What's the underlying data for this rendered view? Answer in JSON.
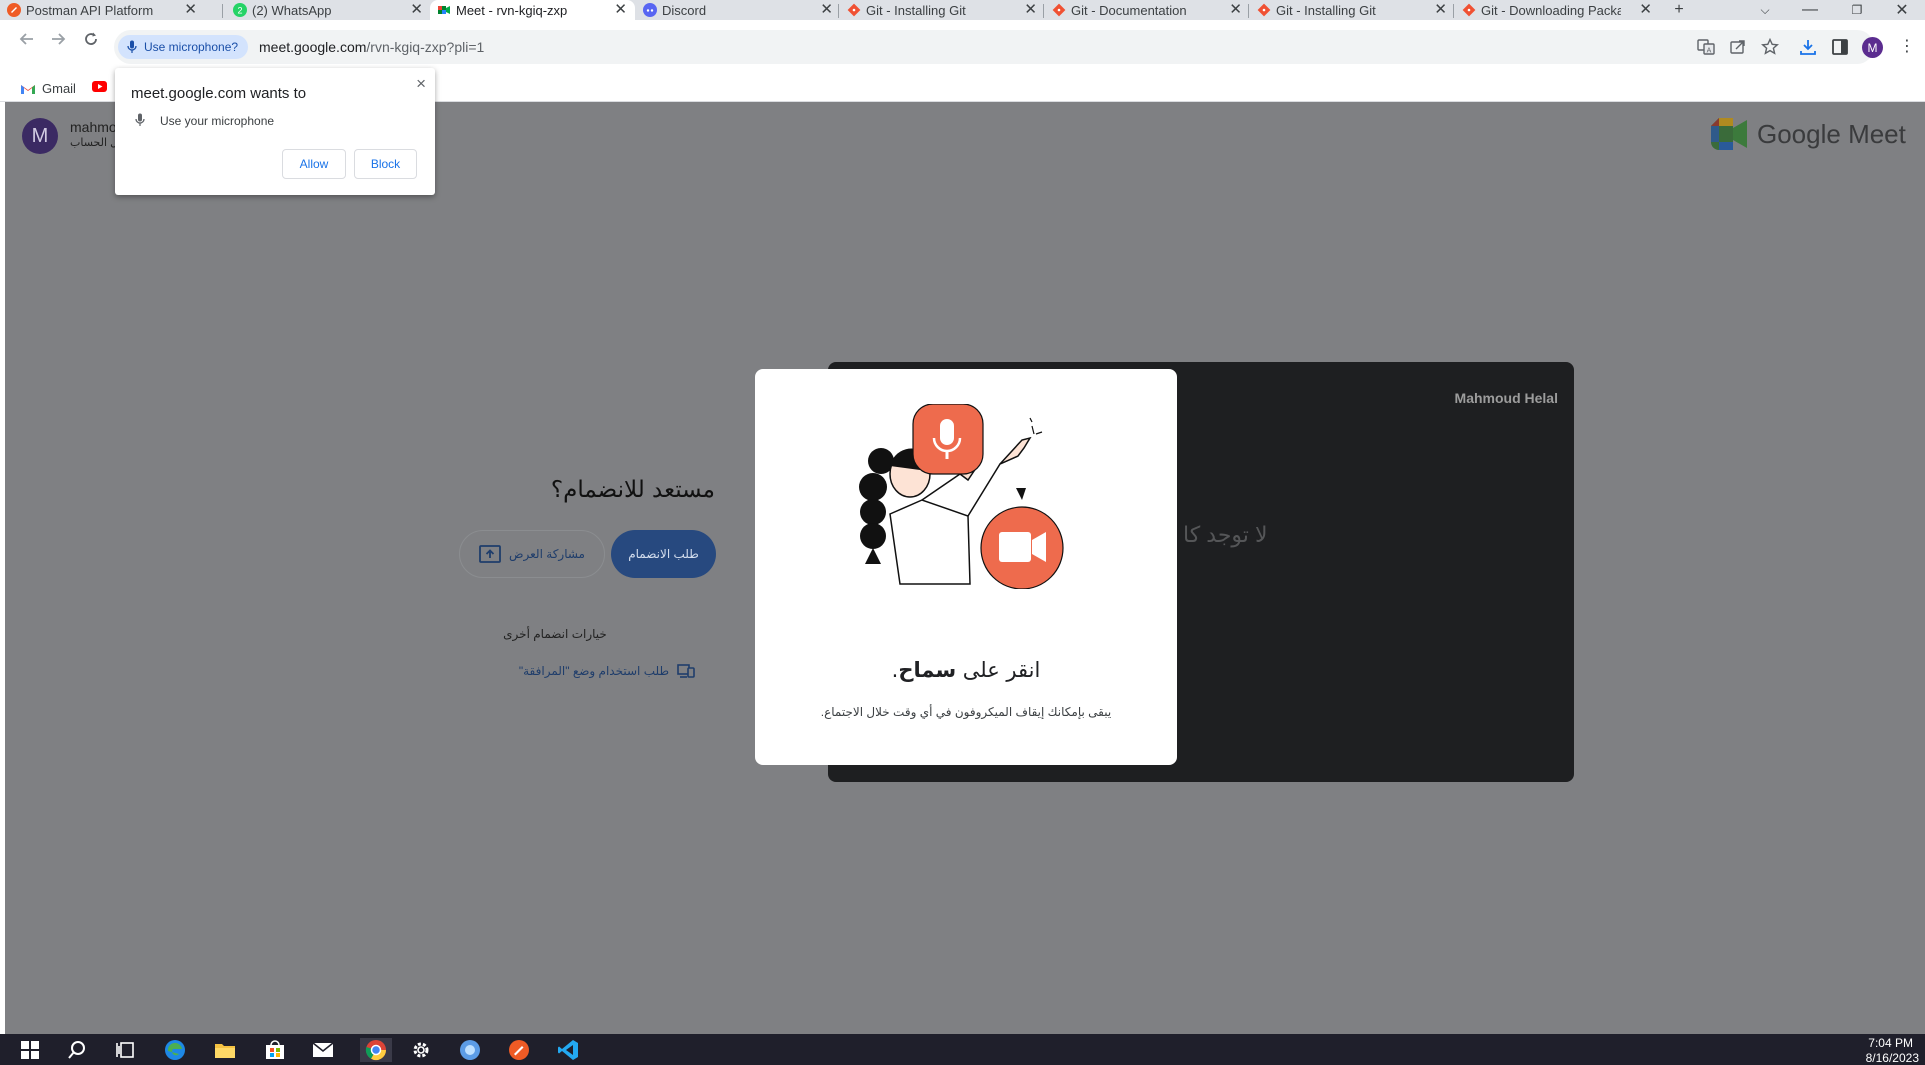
{
  "tabs": [
    {
      "title": "Postman API Platform",
      "active": false
    },
    {
      "title": "(2) WhatsApp",
      "active": false
    },
    {
      "title": "Meet - rvn-kgiq-zxp",
      "active": true
    },
    {
      "title": "Discord",
      "active": false
    },
    {
      "title": "Git - Installing Git",
      "active": false
    },
    {
      "title": "Git - Documentation",
      "active": false
    },
    {
      "title": "Git - Installing Git",
      "active": false
    },
    {
      "title": "Git - Downloading Package",
      "active": false
    }
  ],
  "toolbar": {
    "mic_chip": "Use microphone?",
    "url_host": "meet.google.com",
    "url_path": "/rvn-kgiq-zxp?pli=1",
    "profile_initial": "M"
  },
  "bookmarks": {
    "gmail": "Gmail"
  },
  "mic_popup": {
    "title": "meet.google.com wants to",
    "permission": "Use your microphone",
    "allow": "Allow",
    "block": "Block",
    "close": "×"
  },
  "page": {
    "avatar_initial": "M",
    "user_name": "mahmo",
    "user_sub": "ويل الحساب",
    "logo_text": "Google Meet",
    "ready_title": "مستعد للانضمام؟",
    "join_button": "طلب الانضمام",
    "present_button": "مشاركة العرض",
    "other_options": "خيارات انضمام أخرى",
    "companion_link": "طلب استخدام وضع \"المرافقة\"",
    "preview_name": "Mahmoud Helal",
    "camera_off_text": "لا توجد كا"
  },
  "permission_modal": {
    "title_prefix": "انقر على ",
    "title_bold": "سماح",
    "title_suffix": ".",
    "subtitle": "يبقى بإمكانك إيقاف الميكروفون في أي وقت خلال الاجتماع."
  },
  "taskbar": {
    "time": "7:04 PM",
    "date": "8/16/2023"
  },
  "colors": {
    "page_overlay": "#7f8083",
    "accent_orange": "#ee6b4d",
    "meet_blue": "#27497f",
    "chrome_blue": "#1a73e8"
  }
}
